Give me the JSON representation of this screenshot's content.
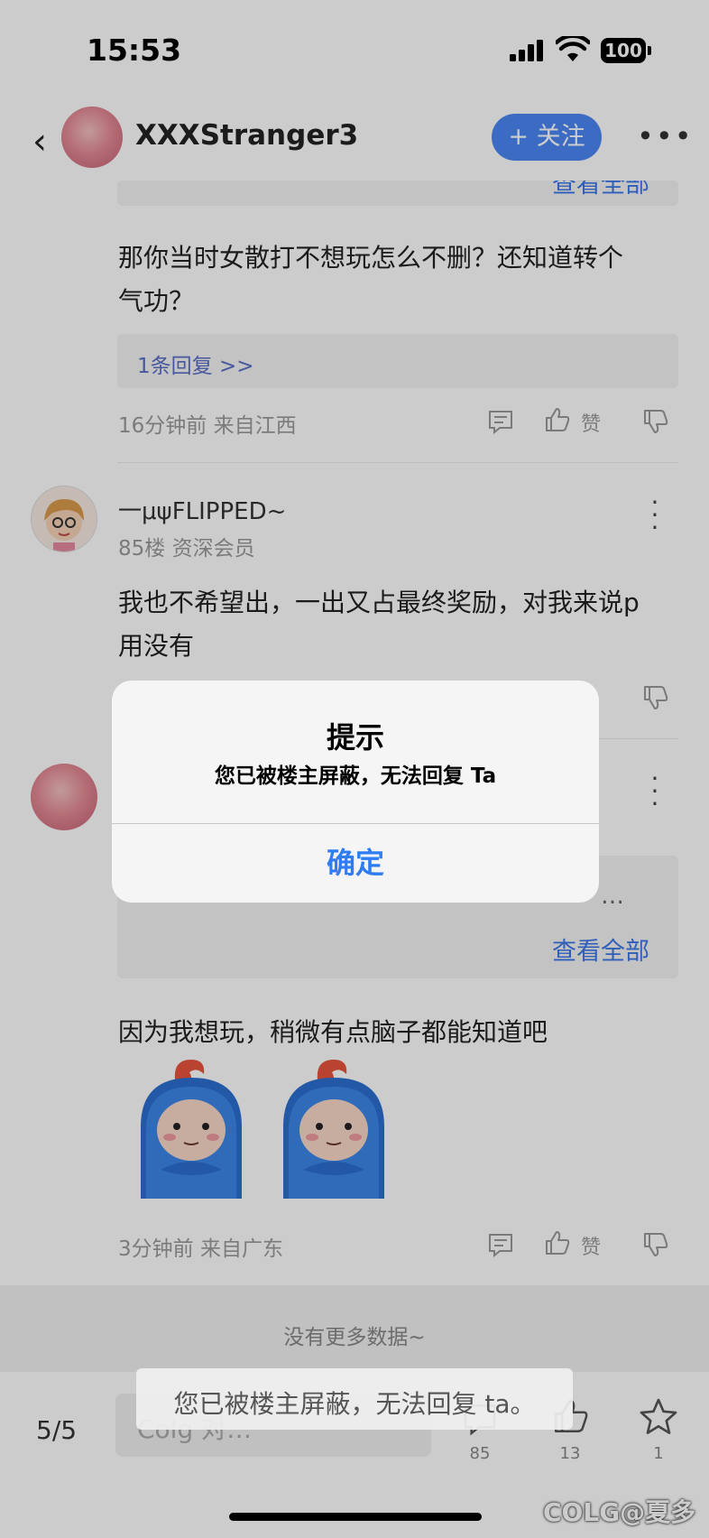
{
  "status": {
    "time": "15:53",
    "battery": "100"
  },
  "header": {
    "username": "XXXStranger3",
    "follow_label": "+ 关注"
  },
  "post1": {
    "top_link": "查看全部",
    "text_line1": "那你当时女散打不想玩怎么不删？还知道转个",
    "text_line2": "气功？",
    "reply_link": "1条回复 >>",
    "meta": "16分钟前 来自江西",
    "like_label": "赞"
  },
  "post2": {
    "username": "一μψFLIPPED~",
    "floor": "85楼 资深会员",
    "text_line1": "我也不希望出，一出又占最终奖励，对我来说p",
    "text_line2": "用没有"
  },
  "post3": {
    "quote_ellipsis": "…",
    "quote_link": "查看全部",
    "text": "因为我想玩，稍微有点脑子都能知道吧",
    "meta": "3分钟前 来自广东",
    "like_label": "赞"
  },
  "list_footer": {
    "no_more": "没有更多数据~"
  },
  "bottom_bar": {
    "page_indicator": "5/5",
    "reply_placeholder": "Colg 对…",
    "comment_count": "85",
    "like_count": "13",
    "star_count": "1"
  },
  "watermark": "COLG@夏多",
  "dialog": {
    "title": "提示",
    "message": "您已被楼主屏蔽，无法回复 Ta",
    "confirm_label": "确定"
  },
  "toast": {
    "text": "您已被楼主屏蔽，无法回复 ta。"
  },
  "colors": {
    "accent": "#4c86f6",
    "dialog_button": "#2f7cf3",
    "link": "#3b77e6"
  }
}
